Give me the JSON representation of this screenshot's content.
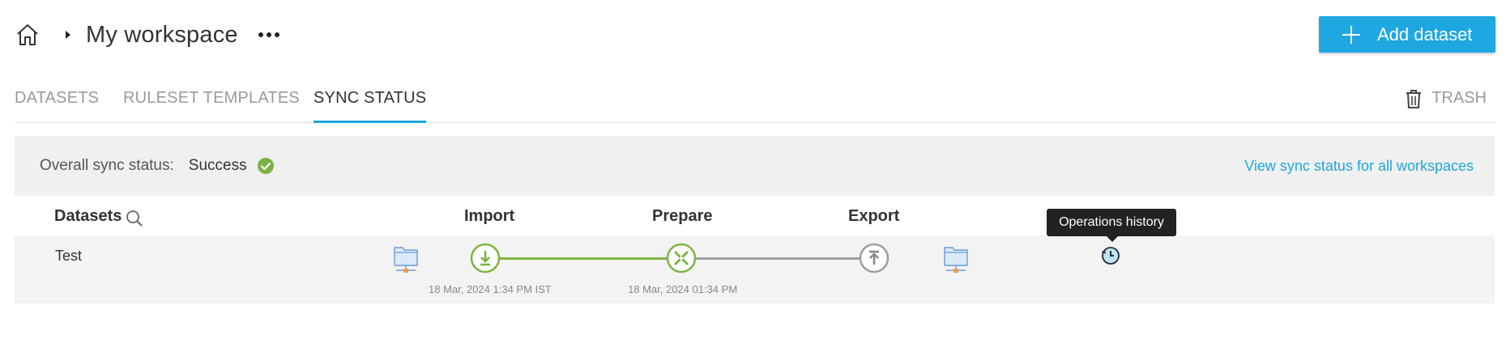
{
  "header": {
    "workspace_title": "My workspace",
    "add_button_label": "Add dataset"
  },
  "tabs": [
    {
      "label": "DATASETS",
      "active": false
    },
    {
      "label": "RULESET TEMPLATES",
      "active": false
    },
    {
      "label": "SYNC STATUS",
      "active": true
    }
  ],
  "trash_label": "TRASH",
  "overall_status": {
    "label": "Overall sync status:",
    "value": "Success",
    "link": "View sync status for all workspaces"
  },
  "table": {
    "headers": {
      "datasets": "Datasets",
      "import": "Import",
      "prepare": "Prepare",
      "export": "Export"
    },
    "rows": [
      {
        "name": "Test",
        "import_time": "18 Mar, 2024 1:34 PM IST",
        "prepare_time": "18 Mar, 2024 01:34 PM",
        "import_status": "done",
        "prepare_status": "done",
        "export_status": "pending"
      }
    ]
  },
  "tooltip": "Operations history",
  "colors": {
    "accent": "#1ea7e1",
    "success": "#7cb342",
    "pending": "#9e9e9e",
    "tooltip_bg": "#222222"
  },
  "icons": {
    "home": "home-icon",
    "caret": "caret-right-icon",
    "more": "more-horizontal-icon",
    "plus": "plus-icon",
    "trash": "trash-icon",
    "success": "check-circle-icon",
    "search": "search-icon",
    "source": "network-folder-icon",
    "import": "download-icon",
    "prepare": "tools-icon",
    "export": "upload-icon",
    "history": "history-icon"
  }
}
